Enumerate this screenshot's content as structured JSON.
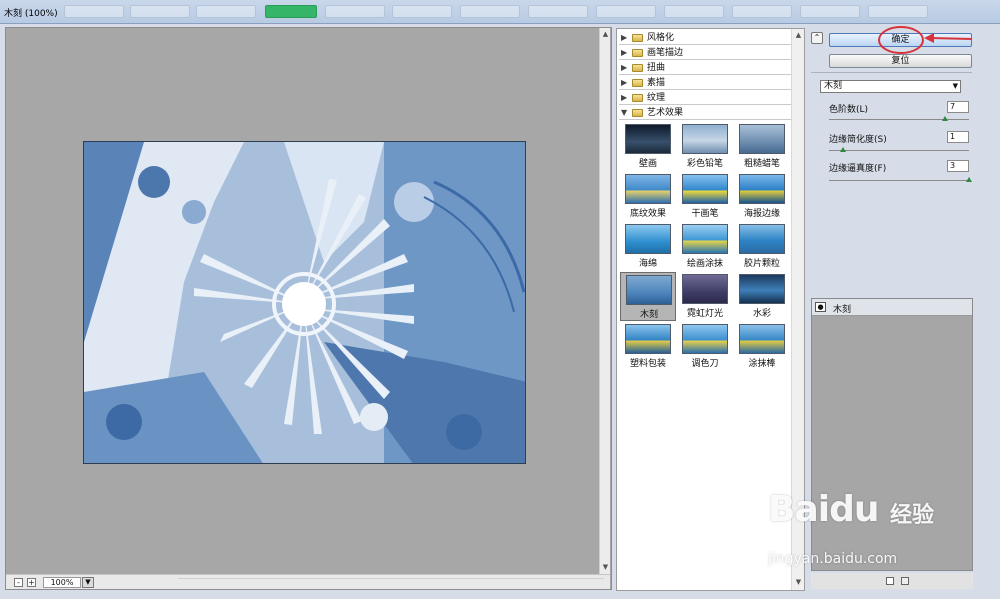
{
  "window": {
    "title": "木刻 (100%)"
  },
  "preview": {
    "zoom": "100%",
    "zoom_out": "-",
    "zoom_in": "+"
  },
  "gallery": {
    "folders": [
      "风格化",
      "画笔描边",
      "扭曲",
      "素描",
      "纹理",
      "艺术效果"
    ],
    "filters": [
      "壁画",
      "彩色铅笔",
      "粗糙蜡笔",
      "底纹效果",
      "干画笔",
      "海报边缘",
      "海绵",
      "绘画涂抹",
      "胶片颗粒",
      "木刻",
      "霓虹灯光",
      "水彩",
      "塑料包装",
      "调色刀",
      "涂抹棒"
    ],
    "selected": "木刻"
  },
  "actions": {
    "ok_label": "确定",
    "reset_label": "复位"
  },
  "settings": {
    "filter_select": "木刻",
    "params": [
      {
        "label": "色阶数(L)",
        "value": "7",
        "fraction": 0.83
      },
      {
        "label": "边缘简化度(S)",
        "value": "1",
        "fraction": 0.1
      },
      {
        "label": "边缘逼真度(F)",
        "value": "3",
        "fraction": 1.0
      }
    ]
  },
  "layers": {
    "items": [
      "木刻"
    ]
  },
  "watermark": {
    "brand": "Baidu",
    "cn": "经验",
    "url": "jingyan.baidu.com"
  },
  "colors": {
    "accent_red": "#d9333a",
    "knob_green": "#2d8a3c"
  }
}
